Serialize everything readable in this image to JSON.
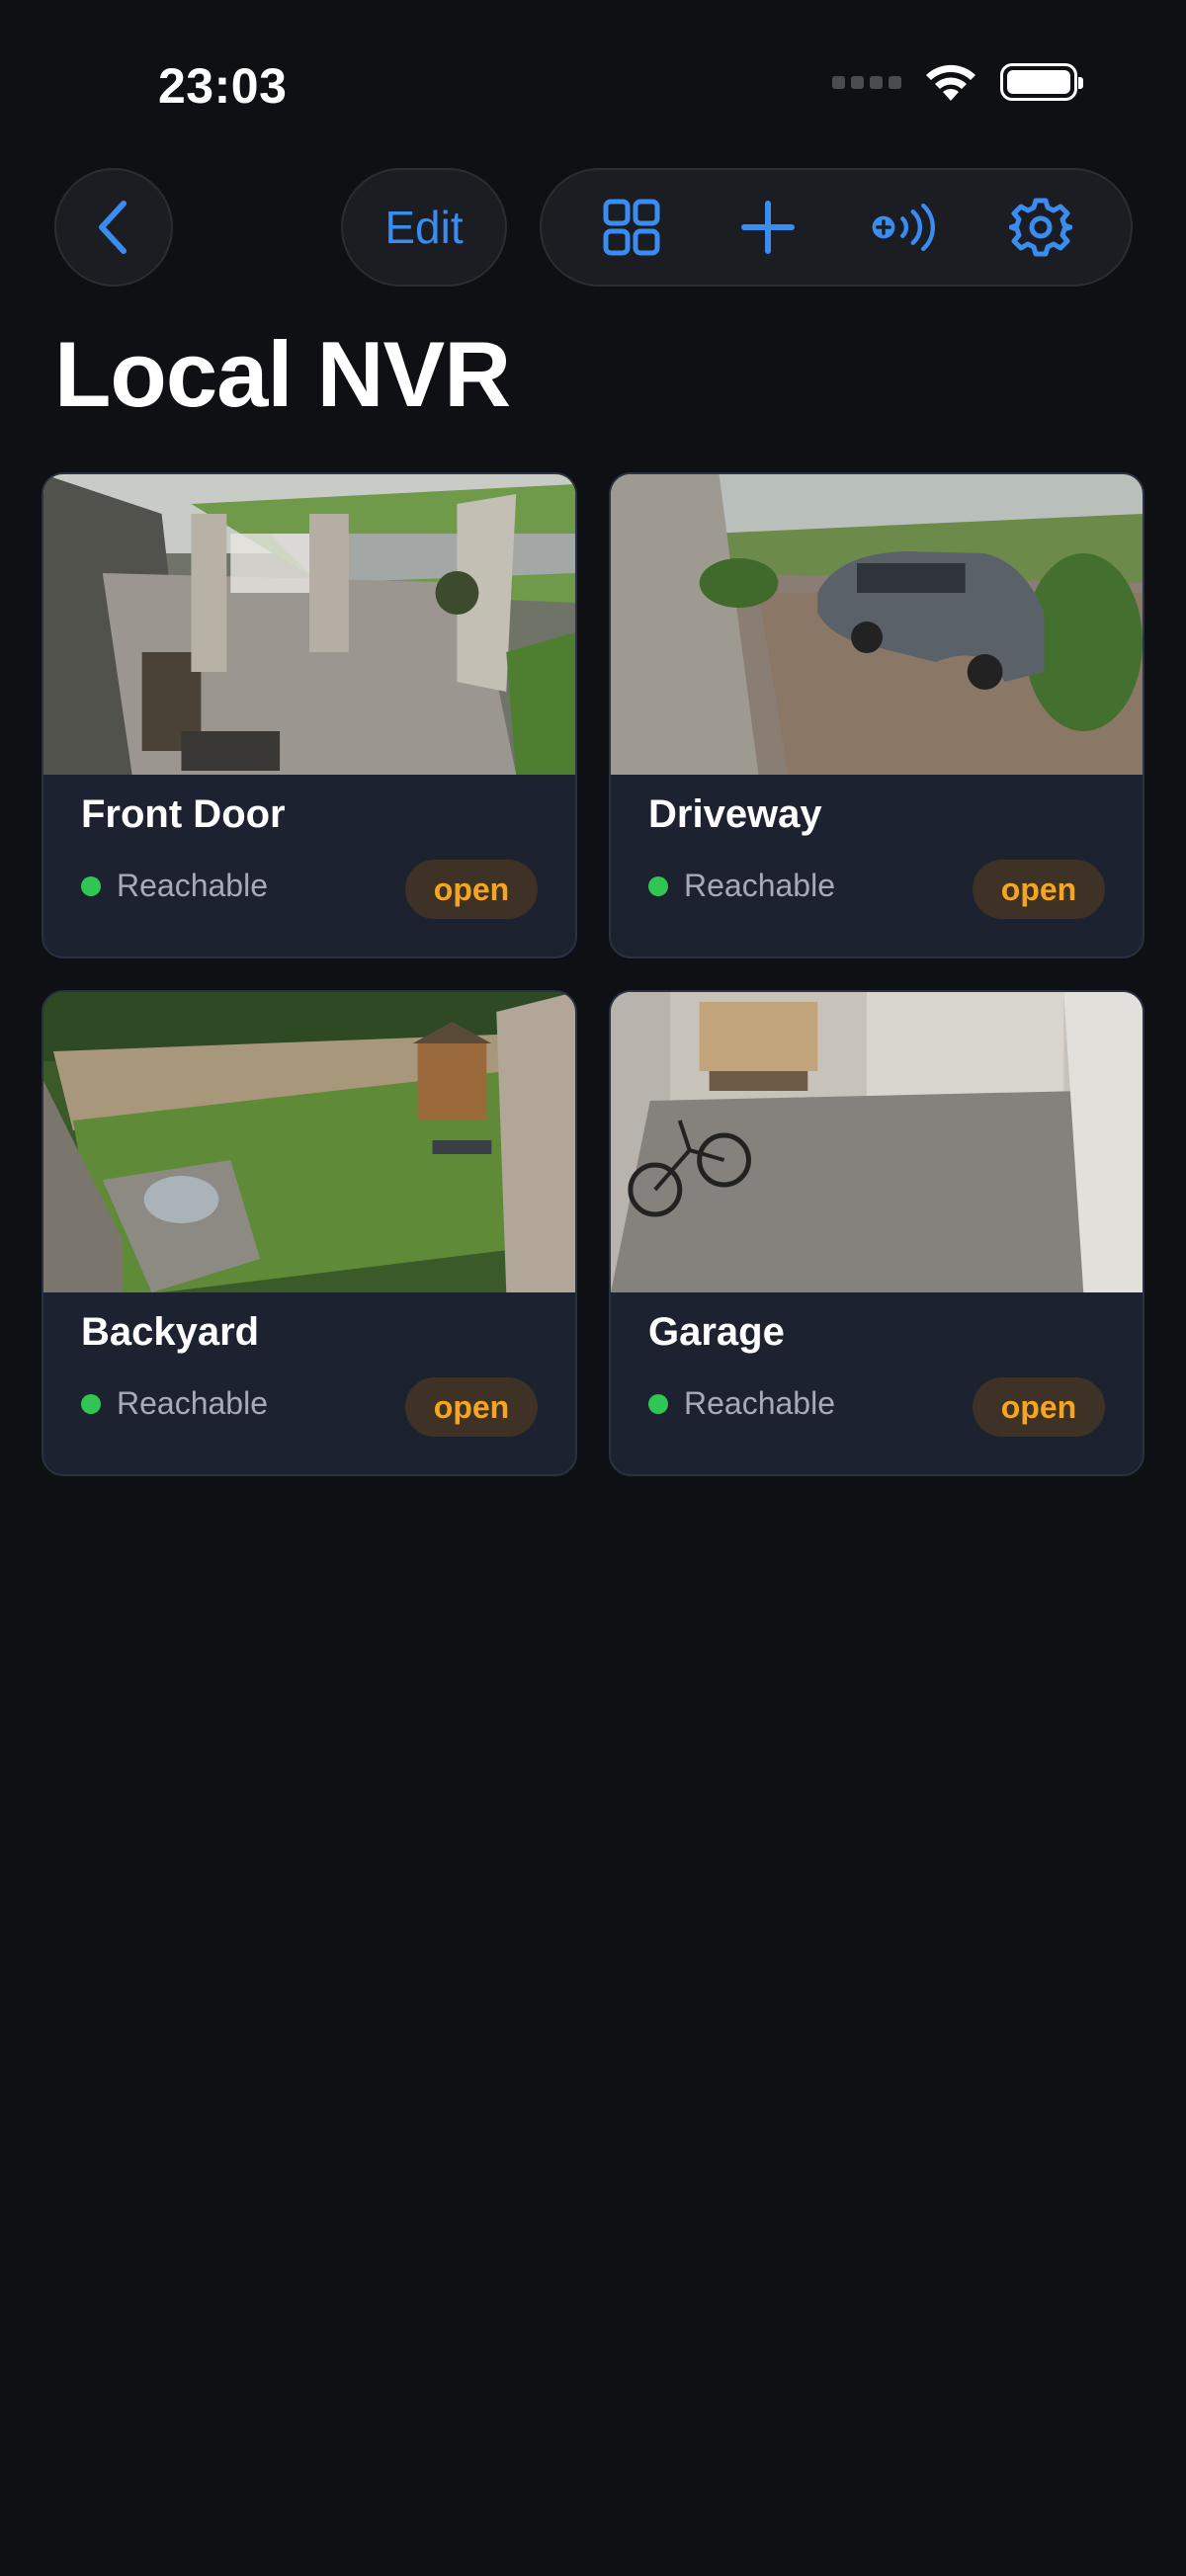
{
  "status_bar": {
    "time": "23:03"
  },
  "toolbar": {
    "back_icon": "chevron-left-icon",
    "edit_label": "Edit",
    "icons": [
      "grid-icon",
      "plus-icon",
      "add-broadcast-icon",
      "gear-icon"
    ]
  },
  "page": {
    "title": "Local NVR"
  },
  "colors": {
    "accent": "#3b8cf0",
    "reachable": "#2fc653",
    "badge_text": "#f4a623",
    "card_bg": "#1c2230"
  },
  "cameras": [
    {
      "name": "Front Door",
      "status": "Reachable",
      "badge": "open"
    },
    {
      "name": "Driveway",
      "status": "Reachable",
      "badge": "open"
    },
    {
      "name": "Backyard",
      "status": "Reachable",
      "badge": "open"
    },
    {
      "name": "Garage",
      "status": "Reachable",
      "badge": "open"
    }
  ]
}
